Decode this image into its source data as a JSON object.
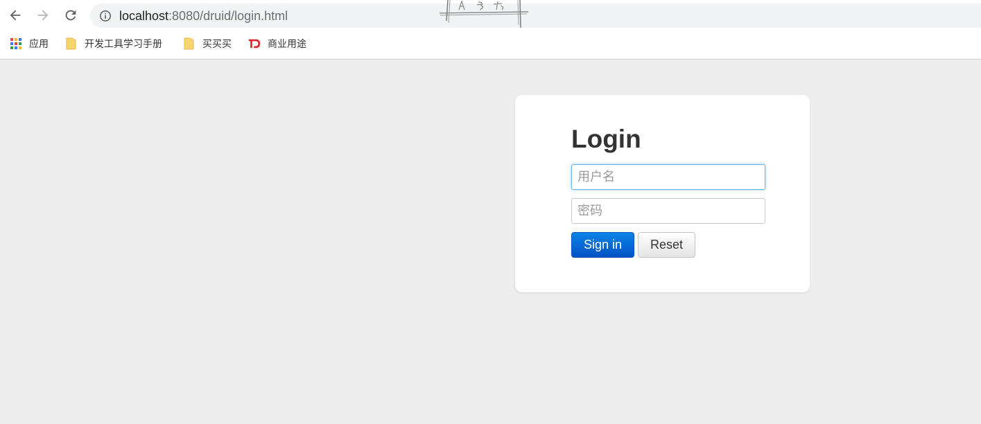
{
  "browser": {
    "url_host": "localhost",
    "url_rest": ":8080/druid/login.html",
    "back_icon": "arrow-left-icon",
    "forward_icon": "arrow-right-icon",
    "reload_icon": "reload-icon",
    "info_icon": "info-icon"
  },
  "bookmarks": {
    "items": [
      {
        "label": "应用",
        "icon": "apps-grid-icon"
      },
      {
        "label": "开发工具学习手册",
        "icon": "folder-icon"
      },
      {
        "label": "买买买",
        "icon": "folder-icon"
      },
      {
        "label": "商业用途",
        "icon": "td-logo-icon"
      }
    ]
  },
  "login": {
    "title": "Login",
    "username_placeholder": "用户名",
    "password_placeholder": "密码",
    "sign_in_label": "Sign in",
    "reset_label": "Reset"
  },
  "colors": {
    "page_background": "#ededed",
    "primary_button": "#0a6ad8",
    "focus_border": "#66afe9",
    "folder_yellow": "#f7d56e",
    "td_red": "#e8232b"
  }
}
